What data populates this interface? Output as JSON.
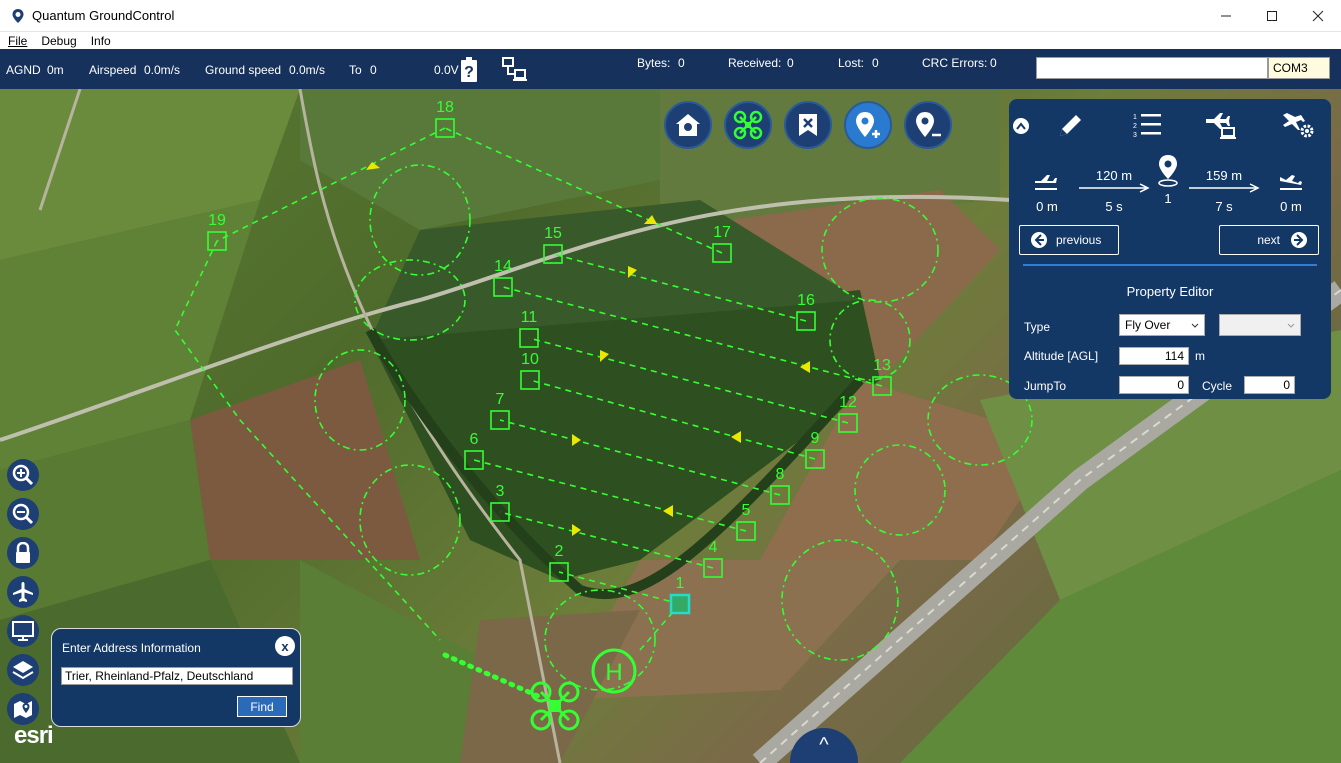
{
  "window": {
    "title": "Quantum GroundControl"
  },
  "menu": [
    "File",
    "Debug",
    "Info"
  ],
  "status": {
    "agnd_label": "AGND",
    "agnd_value": "0m",
    "airspeed_label": "Airspeed",
    "airspeed_value": "0.0m/s",
    "groundspeed_label": "Ground speed",
    "groundspeed_value": "0.0m/s",
    "to_label": "To",
    "to_value": "0",
    "voltage": "0.0V",
    "bytes_label": "Bytes:",
    "bytes_value": "0",
    "received_label": "Received:",
    "received_value": "0",
    "lost_label": "Lost:",
    "lost_value": "0",
    "crc_label": "CRC Errors:",
    "crc_value": "0",
    "com_port": "COM3"
  },
  "action_buttons": [
    "home-icon",
    "drone-icon",
    "clear-mission-icon",
    "add-waypoint-icon",
    "remove-waypoint-icon"
  ],
  "panel": {
    "tabs": [
      "edit-icon",
      "list-icon",
      "plane-link-icon",
      "plane-settings-icon"
    ],
    "segment": {
      "start_alt": "0 m",
      "dist_before": "120 m",
      "time_before": "5 s",
      "current_wp": "1",
      "dist_after": "159 m",
      "time_after": "7 s",
      "end_alt": "0 m"
    },
    "previous_label": "previous",
    "next_label": "next",
    "property_editor_title": "Property Editor",
    "type_label": "Type",
    "type_value": "Fly Over",
    "altitude_label": "Altitude [AGL]",
    "altitude_value": "114",
    "altitude_unit": "m",
    "jumpto_label": "JumpTo",
    "jumpto_value": "0",
    "cycle_label": "Cycle",
    "cycle_value": "0"
  },
  "tools": [
    "zoom-in-icon",
    "zoom-out-icon",
    "lock-icon",
    "airplane-icon",
    "monitor-icon",
    "layers-icon",
    "map-pin-icon"
  ],
  "address": {
    "title": "Enter Address Information",
    "close": "x",
    "value": "Trier, Rheinland-Pfalz, Deutschland",
    "find": "Find"
  },
  "esri_logo": "esri",
  "bottom_toggle": "^",
  "waypoints": [
    "1",
    "2",
    "3",
    "4",
    "5",
    "6",
    "7",
    "8",
    "9",
    "10",
    "11",
    "12",
    "13",
    "14",
    "15",
    "16",
    "17",
    "18",
    "19"
  ],
  "helipad_label": "H",
  "colors": {
    "header": "#16325c",
    "panel": "#143866",
    "route": "#33ff33",
    "arrow": "#e8e800"
  }
}
